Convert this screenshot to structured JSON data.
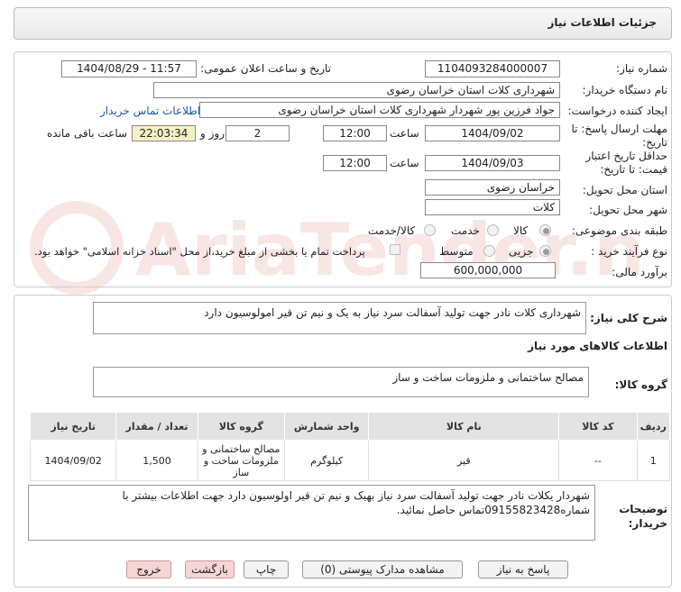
{
  "header": {
    "title": "جزئیات اطلاعات نیاز"
  },
  "form": {
    "need_number_label": "شماره نیاز:",
    "need_number": "1104093284000007",
    "announce_label": "تاریخ و ساعت اعلان عمومی:",
    "announce_value": "1404/08/29 - 11:57",
    "buyer_org_label": "نام دستگاه خریدار:",
    "buyer_org": "شهرداری کلات استان خراسان رضوی",
    "creator_label": "ایجاد کننده درخواست:",
    "creator": "جواد فرزین پور شهردار شهرداری کلات استان خراسان رضوی",
    "contact_link": "اطلاعات تماس خریدار",
    "reply_deadline_label": "مهلت ارسال پاسخ: تا تاریخ:",
    "reply_date": "1404/09/02",
    "time_label": "ساعت",
    "reply_time": "12:00",
    "days_value": "2",
    "days_and_label": "روز و",
    "remaining_time": "22:03:34",
    "remaining_label": "ساعت باقی مانده",
    "validity_label": "حداقل تاریخ اعتبار قیمت: تا تاریخ:",
    "validity_date": "1404/09/03",
    "validity_time": "12:00",
    "province_label": "استان محل تحویل:",
    "province": "خراسان رضوی",
    "city_label": "شهر محل تحویل:",
    "city": "کلات",
    "category_label": "طبقه بندی موضوعی:",
    "category_options": [
      "کالا",
      "خدمت",
      "کالا/خدمت"
    ],
    "process_label": "نوع فرآیند خرید :",
    "process_options": [
      "جزیی",
      "متوسط"
    ],
    "payment_note": "پرداخت تمام یا بخشی از مبلغ خرید،از محل \"اسناد خزانه اسلامی\" خواهد بود.",
    "budget_label": "برآورد مالی:",
    "budget": "600,000,000"
  },
  "description": {
    "label": "شرح کلی نیاز:",
    "value": "شهرداری کلات نادر جهت تولید آسفالت سرد نیاز به یک و نیم تن قیر امولوسیون دارد"
  },
  "goods": {
    "section_title": "اطلاعات کالاهای مورد نیاز",
    "group_label": "گروه کالا:",
    "group_value": "مصالح ساختمانی و ملزومات ساخت و ساز",
    "columns": [
      "ردیف",
      "کد کالا",
      "نام کالا",
      "واحد شمارش",
      "گروه کالا",
      "تعداد / مقدار",
      "تاریخ نیاز"
    ],
    "rows": [
      {
        "row": "1",
        "code": "--",
        "name": "قیر",
        "unit": "کیلوگرم",
        "group": "مصالح ساختمانی و ملزومات ساخت و ساز",
        "qty": "1,500",
        "date": "1404/09/02"
      }
    ]
  },
  "buyer_notes": {
    "label": "توضیحات خریدار:",
    "value": "شهردار یکلات نادر جهت تولید آسفالت سرد نیاز بهیک و نیم تن قیر اولوسیون دارد جهت اطلاعات بیشتر با شماره09155823428تماس حاصل نمائید."
  },
  "buttons": {
    "reply": "پاسخ به نیاز",
    "attachments": "مشاهده مدارک پیوستی (0)",
    "print": "چاپ",
    "back": "بازگشت",
    "exit": "خروج"
  },
  "watermark": {
    "text": "AriaTender.neT"
  }
}
